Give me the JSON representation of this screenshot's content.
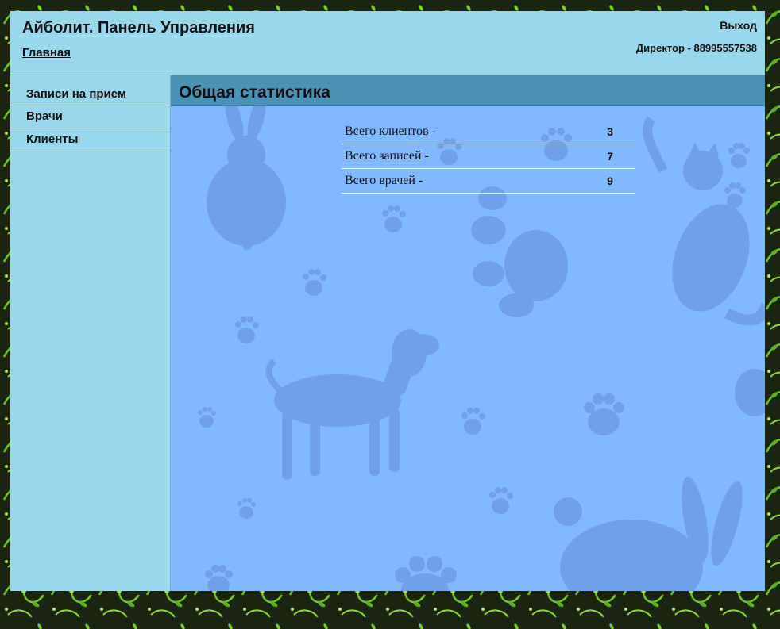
{
  "header": {
    "title": "Айболит. Панель Управления",
    "home_link": "Главная",
    "logout": "Выход",
    "user_info": "Директор - 88995557538"
  },
  "sidebar": {
    "items": [
      {
        "label": "Записи на прием"
      },
      {
        "label": "Врачи"
      },
      {
        "label": "Клиенты"
      }
    ]
  },
  "main": {
    "title": "Общая статистика",
    "stats": [
      {
        "label": "Всего клиентов -",
        "value": "3"
      },
      {
        "label": "Всего записей -",
        "value": "7"
      },
      {
        "label": "Всего врачей -",
        "value": "9"
      }
    ]
  },
  "colors": {
    "header_bg": "#99d8ea",
    "content_bg": "#80b9ff",
    "title_bar_bg": "#4a92b5",
    "page_bg": "#1b2410",
    "pattern_green": "#6fc520"
  }
}
